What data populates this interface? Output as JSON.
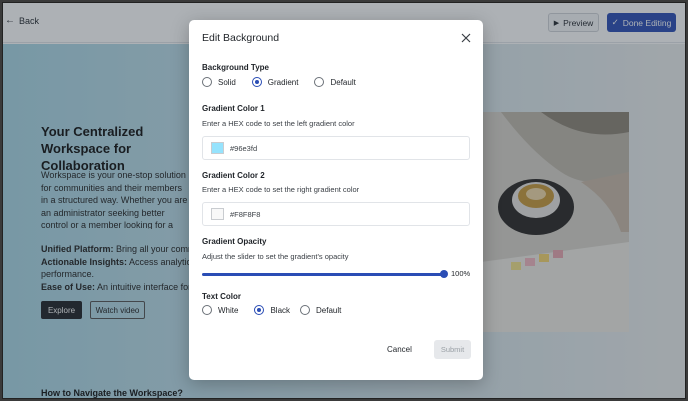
{
  "topbar": {
    "back_label": "Back",
    "preview_label": "Preview",
    "done_label": "Done Editing"
  },
  "page": {
    "hero_title": "Your Centralized Workspace for Collaboration",
    "hero_desc": "Workspace is your one-stop solution for communities and their members in a structured way. Whether you are an administrator seeking better control or a member looking for a seamless experience, Workspace provides all the tools you need to foster innovation and engagement.",
    "features": [
      {
        "label": "Unified Platform:",
        "text": " Bring all your communities together"
      },
      {
        "label": "Actionable Insights:",
        "text": " Access analytics that drive"
      },
      {
        "label": "",
        "text": "performance."
      },
      {
        "label": "Ease of Use:",
        "text": " An intuitive interface for all users"
      }
    ],
    "explore_label": "Explore",
    "watch_label": "Watch video",
    "how_title": "How to Navigate the Workspace?"
  },
  "modal": {
    "title": "Edit Background",
    "bg_type": {
      "title": "Background Type",
      "options": [
        "Solid",
        "Gradient",
        "Default"
      ],
      "selected": "Gradient"
    },
    "color1": {
      "title": "Gradient Color 1",
      "hint": "Enter a HEX code to set the left gradient color",
      "value": "#96e3fd",
      "swatch": "#96e3fd"
    },
    "color2": {
      "title": "Gradient Color 2",
      "hint": "Enter a HEX code to set the right gradient color",
      "value": "#F8F8F8",
      "swatch": "#F8F8F8"
    },
    "opacity": {
      "title": "Gradient Opacity",
      "hint": "Adjust the slider to set the gradient's opacity",
      "value_label": "100%",
      "value": 1.0
    },
    "text_color": {
      "title": "Text Color",
      "options": [
        "White",
        "Black",
        "Default"
      ],
      "selected": "Black"
    },
    "cancel_label": "Cancel",
    "submit_label": "Submit"
  },
  "colors": {
    "accent": "#2a4db5"
  }
}
